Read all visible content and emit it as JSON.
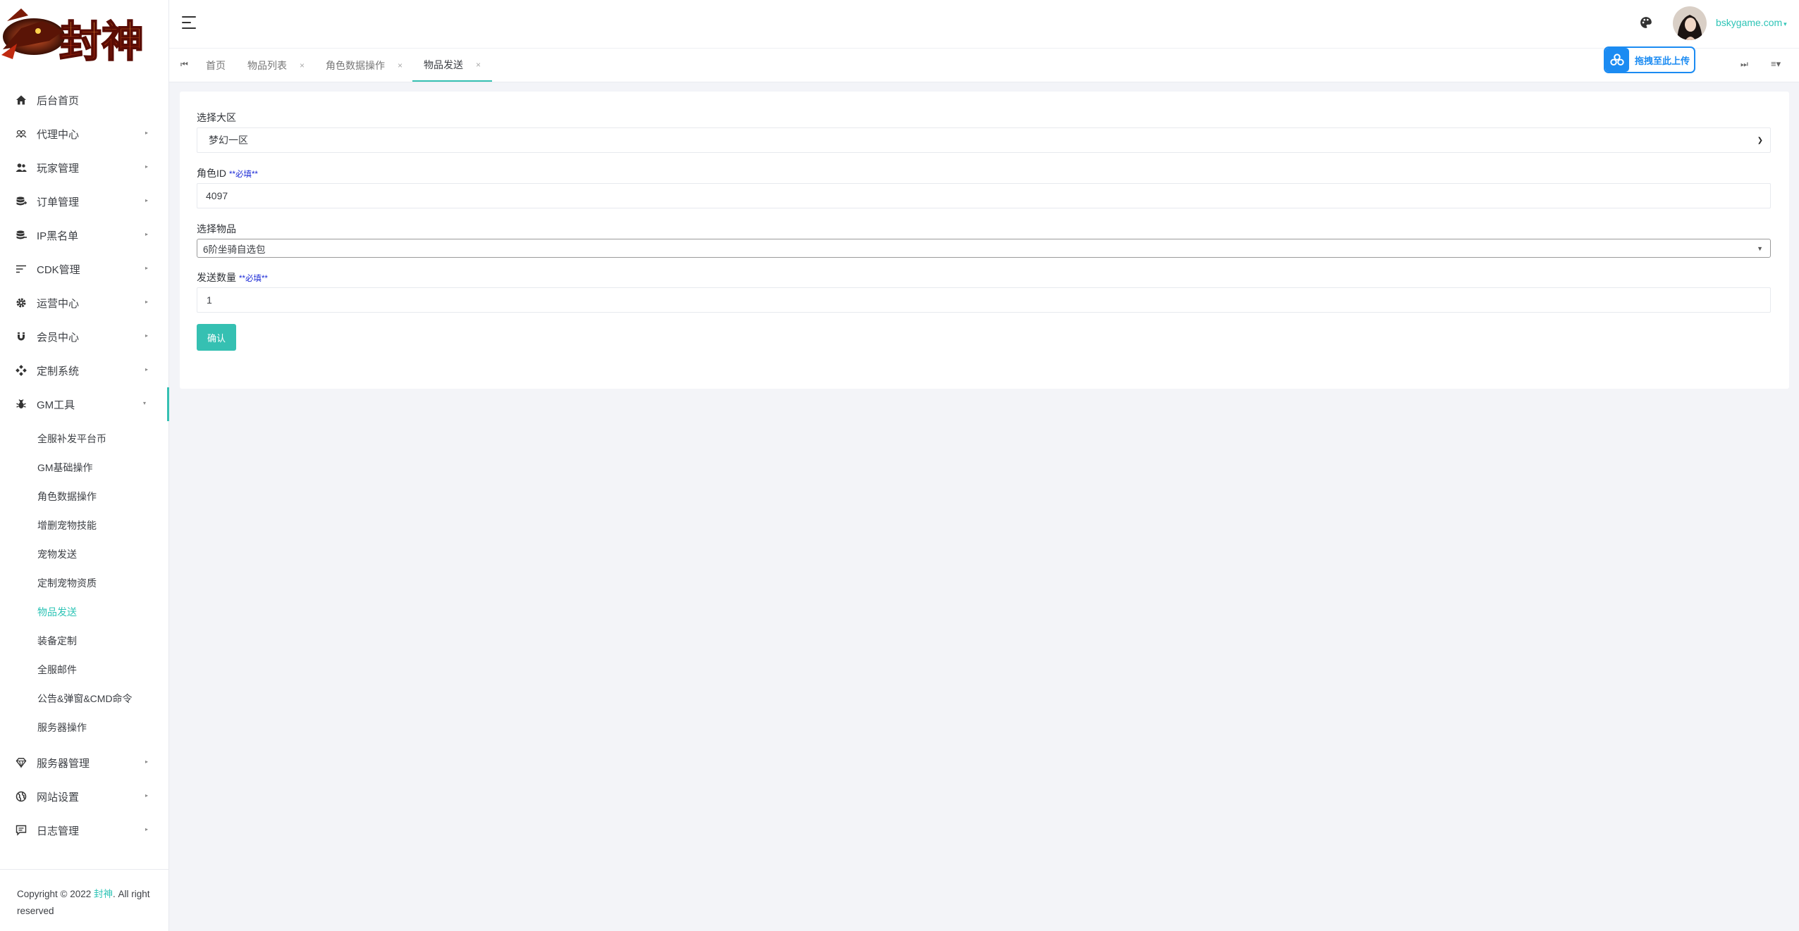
{
  "logo": {
    "text": "封神"
  },
  "sidebar": {
    "items": [
      {
        "label": "后台首页",
        "icon": "home-icon",
        "expandable": false
      },
      {
        "label": "代理中心",
        "icon": "agents-icon",
        "expandable": true
      },
      {
        "label": "玩家管理",
        "icon": "players-icon",
        "expandable": true
      },
      {
        "label": "订单管理",
        "icon": "orders-icon",
        "expandable": true
      },
      {
        "label": "IP黑名单",
        "icon": "database-icon",
        "expandable": true
      },
      {
        "label": "CDK管理",
        "icon": "sort-lines-icon",
        "expandable": true
      },
      {
        "label": "运营中心",
        "icon": "gear-icon",
        "expandable": true
      },
      {
        "label": "会员中心",
        "icon": "magnet-icon",
        "expandable": true
      },
      {
        "label": "定制系统",
        "icon": "gamepad-icon",
        "expandable": true
      },
      {
        "label": "GM工具",
        "icon": "bug-icon",
        "expandable": true,
        "open": true
      }
    ],
    "gm_sub_items": [
      {
        "label": "全服补发平台币"
      },
      {
        "label": "GM基础操作"
      },
      {
        "label": "角色数据操作"
      },
      {
        "label": "增删宠物技能"
      },
      {
        "label": "宠物发送"
      },
      {
        "label": "定制宠物资质"
      },
      {
        "label": "物品发送",
        "active": true
      },
      {
        "label": "装备定制"
      },
      {
        "label": "全服邮件"
      },
      {
        "label": "公告&弹窗&CMD命令"
      },
      {
        "label": "服务器操作"
      }
    ],
    "bottom_items": [
      {
        "label": "服务器管理",
        "icon": "diamond-icon"
      },
      {
        "label": "网站设置",
        "icon": "globe-icon"
      },
      {
        "label": "日志管理",
        "icon": "comment-icon"
      }
    ],
    "copyright_prefix": "Copyright © 2022 ",
    "copyright_brand": "封神",
    "copyright_suffix": ". All right reserved"
  },
  "topbar": {
    "username": "bskygame.com"
  },
  "tabs": [
    {
      "label": "首页",
      "closable": false
    },
    {
      "label": "物品列表",
      "closable": true
    },
    {
      "label": "角色数据操作",
      "closable": true
    },
    {
      "label": "物品发送",
      "closable": true,
      "active": true
    }
  ],
  "upload_button": {
    "label": "拖拽至此上传"
  },
  "form": {
    "region_label": "选择大区",
    "region_value": "梦幻一区",
    "role_id_label": "角色ID",
    "role_id_required": "**必填**",
    "role_id_value": "4097",
    "item_label": "选择物品",
    "item_value": "6阶坐骑自选包",
    "qty_label": "发送数量",
    "qty_required": "**必填**",
    "qty_value": "1",
    "confirm_label": "确认"
  },
  "colors": {
    "accent": "#35c0b2",
    "link": "#2ec4b6",
    "required": "#1b2ad6",
    "upload": "#1b8bf2"
  }
}
